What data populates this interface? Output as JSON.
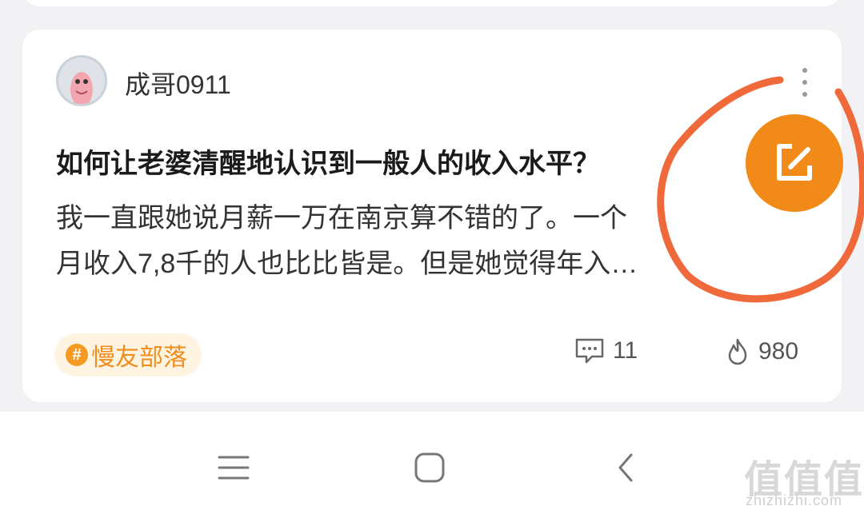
{
  "post": {
    "author": "成哥0911",
    "title": "如何让老婆清醒地认识到一般人的收入水平？",
    "excerpt_line1": "我一直跟她说月薪一万在南京算不错的了。一个",
    "excerpt_line2": "月收入7,8千的人也比比皆是。但是她觉得年入…",
    "tag_symbol": "#",
    "tag": "慢友部落",
    "comments": "11",
    "heat": "980"
  },
  "icons": {
    "more": "more-vertical-icon",
    "edit": "edit-icon",
    "comment": "comment-icon",
    "flame": "flame-icon",
    "menu": "menu-icon",
    "home": "home-square-icon",
    "back": "back-chevron-icon"
  },
  "watermark": {
    "logo": "值值值",
    "url": "zhizhizhi.com"
  },
  "colors": {
    "accent": "#f28a1a",
    "tag_bg": "#fff3e2",
    "annotation": "#f0693a"
  }
}
